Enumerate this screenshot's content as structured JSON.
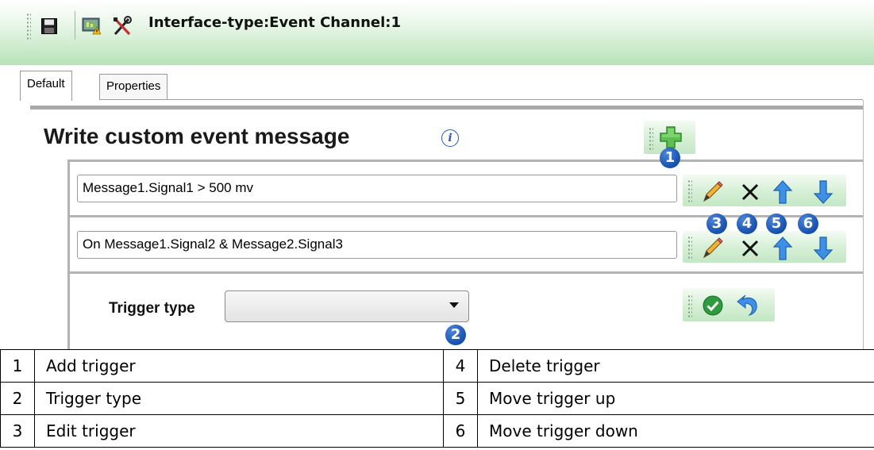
{
  "window": {
    "title": "Interface-type:Event Channel:1",
    "toolbar_icons": [
      "save-icon",
      "monitor-icon",
      "tools-icon"
    ]
  },
  "tabs": [
    {
      "label": "Default",
      "selected": true
    },
    {
      "label": "Properties",
      "selected": false
    }
  ],
  "panel": {
    "title": "Write custom event message",
    "info_icon": "info-icon",
    "triggers": [
      {
        "expression": "Message1.Signal1  >  500 mv"
      },
      {
        "expression": "On Message1.Signal2 & Message2.Signal3"
      }
    ],
    "row_actions": [
      "edit-icon",
      "delete-icon",
      "arrow-up-icon",
      "arrow-down-icon"
    ],
    "trigger_type": {
      "label": "Trigger type",
      "value": ""
    },
    "confirm_actions": [
      "checkmark-icon",
      "undo-icon"
    ]
  },
  "callouts": [
    "1",
    "2",
    "3",
    "4",
    "5",
    "6"
  ],
  "legend": [
    {
      "left_num": "1",
      "left_text": "Add trigger",
      "right_num": "4",
      "right_text": "Delete trigger"
    },
    {
      "left_num": "2",
      "left_text": "Trigger type",
      "right_num": "5",
      "right_text": "Move trigger up"
    },
    {
      "left_num": "3",
      "left_text": "Edit trigger",
      "right_num": "6",
      "right_text": "Move trigger down"
    }
  ],
  "colors": {
    "toolbar_green": "#b6e2b8",
    "callout_blue": "#1b57b4",
    "arrow_blue": "#2f7fe0",
    "check_green": "#2e9b3e"
  }
}
